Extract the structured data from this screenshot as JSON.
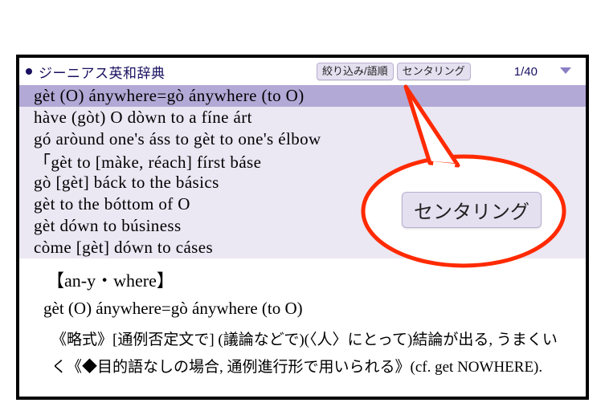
{
  "header": {
    "dictName": "ジーニアス英和辞典",
    "btnFilter": "絞り込み/語順",
    "btnCentering": "センタリング",
    "pager": "1/40"
  },
  "list": [
    "gèt (O) ánywhere=gò ánywhere (to O)",
    "hàve (gòt) O dòwn to a fíne árt",
    "gó aròund one's áss to gèt to one's élbow",
    "「gèt to [màke, réach] fírst báse",
    "gò [gèt] báck to the básics",
    "gèt to the bóttom of O",
    "gèt dówn to búsiness",
    "còme [gèt] dówn to cáses"
  ],
  "detail": {
    "headword": "【an-y・where】",
    "phrase": "gèt (O) ánywhere=gò ánywhere (to O)",
    "def_pre": "《略式》[通例否定文で] (議論などで)(〈人〉にとって)結論が出る, うまくいく《◆目的語なしの場合, 通例進行形で用いられる》(cf. get ",
    "def_small": "NOWHERE",
    "def_post": ")."
  },
  "callout": {
    "label": "センタリング"
  }
}
